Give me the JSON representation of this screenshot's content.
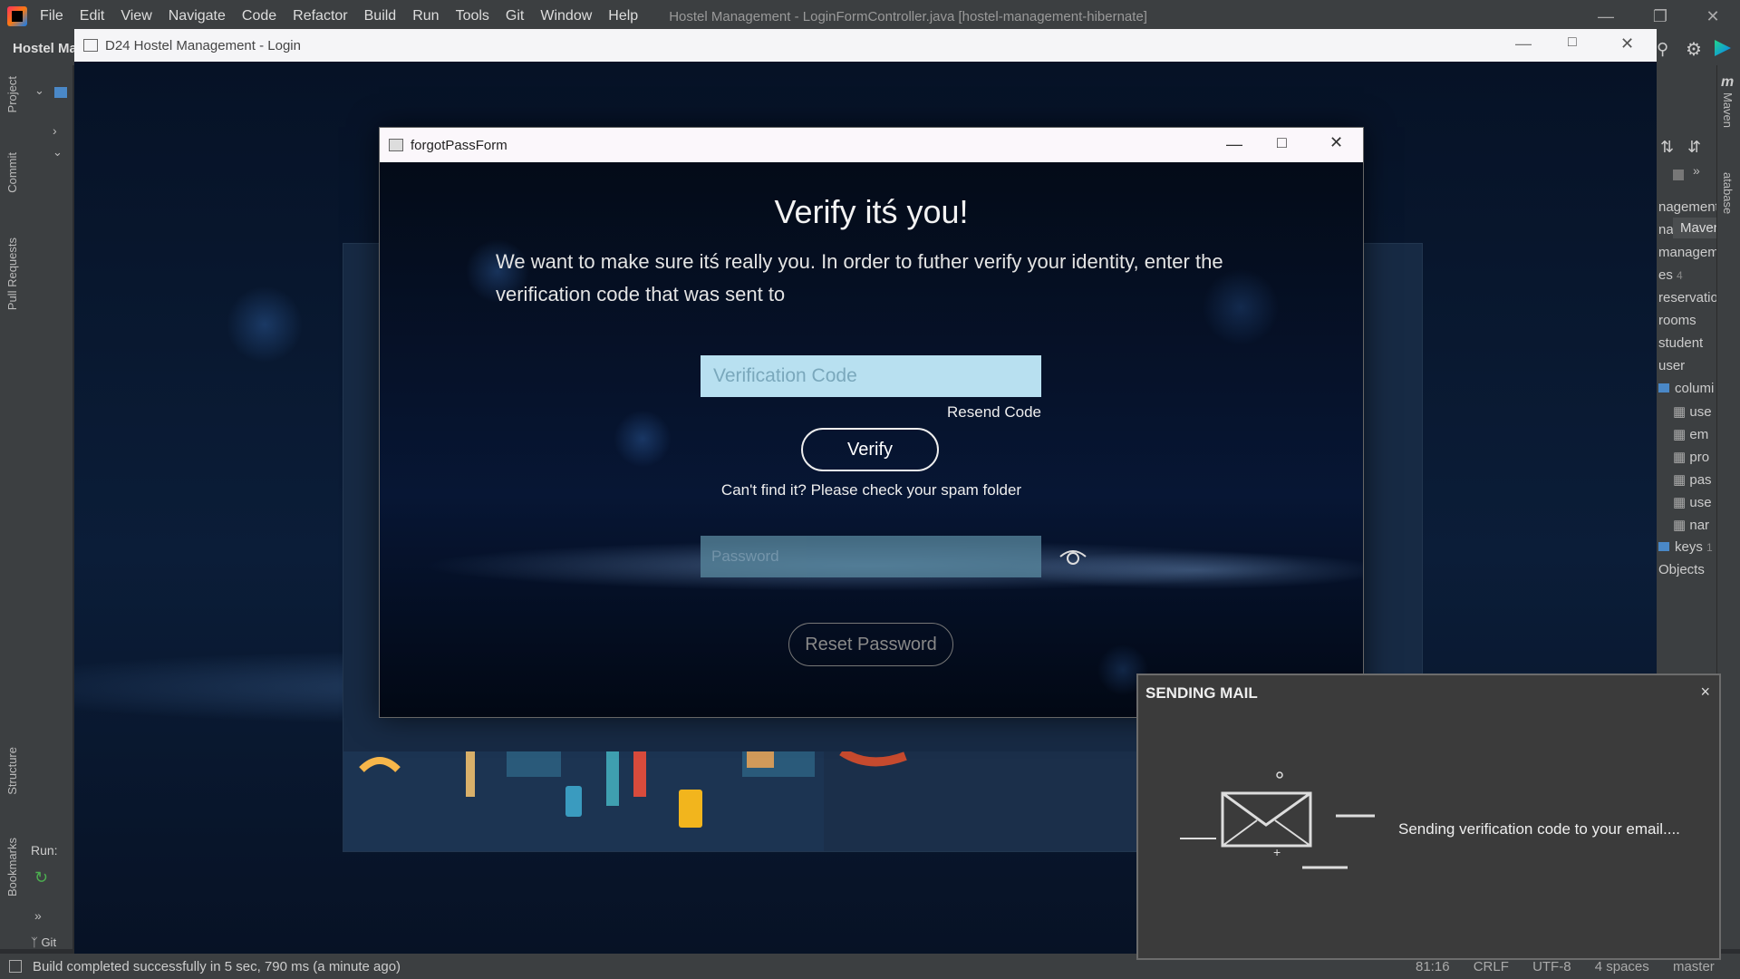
{
  "ide": {
    "menu": [
      "File",
      "Edit",
      "View",
      "Navigate",
      "Code",
      "Refactor",
      "Build",
      "Run",
      "Tools",
      "Git",
      "Window",
      "Help"
    ],
    "title": "Hostel Management - LoginFormController.java [hostel-management-hibernate]",
    "project_label": "Hostel Ma",
    "left_stripe": [
      "Project",
      "Commit",
      "Pull Requests",
      "Structure",
      "Bookmarks"
    ],
    "run_label": "Run:",
    "git_label": "Git",
    "right_panel_items": [
      "nagement",
      "nag",
      "managem",
      "es",
      "reservatio",
      "rooms",
      "student",
      "user",
      "columi",
      "use",
      "em",
      "pro",
      "pas",
      "use",
      "nar",
      "keys",
      "Objects"
    ],
    "right_panel_counts": {
      "es": "4",
      "keys": "1"
    },
    "maven_label": "Maven",
    "database_label": "atabase",
    "maven_tab": "Maven",
    "status_text": "Build completed successfully in 5 sec, 790 ms (a minute ago)",
    "status_right": [
      "81:16",
      "CRLF",
      "UTF-8",
      "4 spaces",
      "master"
    ]
  },
  "login_window": {
    "title": "D24 Hostel Management - Login"
  },
  "dialog": {
    "title": "forgotPassForm",
    "heading": "Verify itś you!",
    "description": "We want to make sure itś really you. In order to futher verify your identity, enter the verification code that was sent to",
    "verification_placeholder": "Verification Code",
    "resend_label": "Resend Code",
    "verify_label": "Verify",
    "spam_hint": "Can't find it? Please check your spam folder",
    "password_placeholder": "Password",
    "reset_label": "Reset Password"
  },
  "mail_popup": {
    "title": "SENDING MAIL",
    "message": "Sending verification code to your email....",
    "close_glyph": "×"
  },
  "colors": {
    "ide_bg": "#3c3f41",
    "input_cyan": "#b8e0f0",
    "dialog_bg": "#071634"
  }
}
